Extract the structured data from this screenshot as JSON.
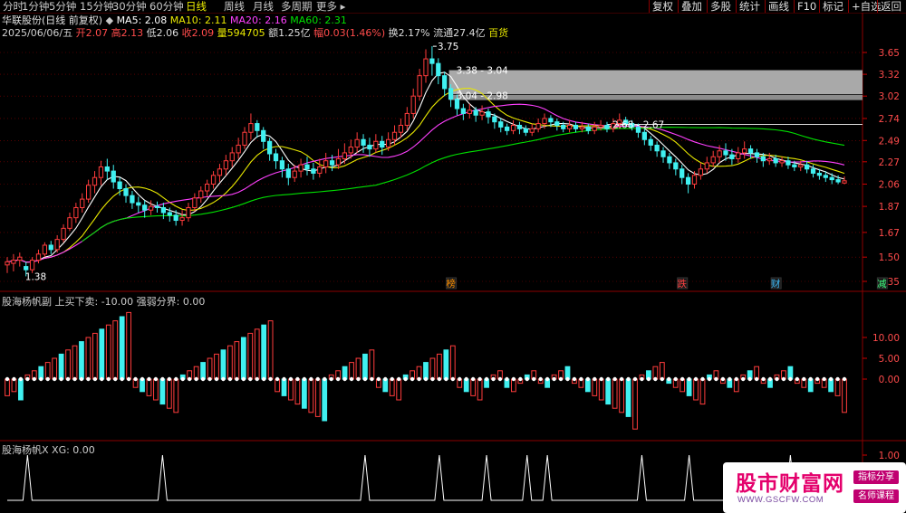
{
  "topbar": {
    "periods": [
      "分时",
      "1分钟",
      "5分钟",
      "15分钟",
      "30分钟",
      "60分钟",
      "日线",
      "周线",
      "月线",
      "多周期",
      "更多"
    ],
    "active_period": "日线",
    "right_buttons": [
      "复权",
      "叠加",
      "多股",
      "统计",
      "画线",
      "F10",
      "标记",
      "+自选",
      "返回"
    ]
  },
  "stock": {
    "name_line": "华联股份(日线 前复权)",
    "ma5": "MA5: 2.08",
    "ma10": "MA10: 2.11",
    "ma20": "MA20: 2.16",
    "ma60": "MA60: 2.31",
    "date": "2025/06/06/五",
    "open": "开2.07",
    "high": "高2.13",
    "low": "低2.06",
    "close": "收2.09",
    "volume": "量594705",
    "amount": "额1.25亿",
    "change": "幅0.03(1.46%)",
    "turnover": "换2.17%",
    "float": "流通27.4亿",
    "sector": "百货"
  },
  "colors": {
    "ma5": "#ffffff",
    "ma10": "#e8e800",
    "ma20": "#ff40ff",
    "ma60": "#00e000",
    "up": "#ff3c3c",
    "down": "#40f0f0",
    "grid": "#8b0000"
  },
  "chart_data": [
    {
      "type": "candlestick",
      "title": "华联股份(日线 前复权)",
      "y_ticks": [
        3.65,
        3.32,
        3.02,
        2.74,
        2.49,
        2.27,
        2.06,
        1.87,
        1.67,
        1.5,
        1.35
      ],
      "ylim": [
        1.3,
        3.85
      ],
      "annotations": [
        "3.75",
        "3.38 - 3.04",
        "3.04 - 2.98",
        "2.68 - 2.67",
        "1.38"
      ],
      "event_markers": [
        "榜",
        "跌",
        "财",
        "减"
      ],
      "candles": [
        [
          1.45,
          1.47,
          1.4,
          1.5
        ],
        [
          1.46,
          1.48,
          1.41,
          1.52
        ],
        [
          1.48,
          1.5,
          1.44,
          1.53
        ],
        [
          1.44,
          1.42,
          1.38,
          1.47
        ],
        [
          1.42,
          1.48,
          1.4,
          1.5
        ],
        [
          1.48,
          1.52,
          1.46,
          1.55
        ],
        [
          1.52,
          1.58,
          1.5,
          1.6
        ],
        [
          1.58,
          1.55,
          1.52,
          1.61
        ],
        [
          1.55,
          1.62,
          1.53,
          1.65
        ],
        [
          1.62,
          1.7,
          1.6,
          1.73
        ],
        [
          1.7,
          1.78,
          1.68,
          1.82
        ],
        [
          1.78,
          1.86,
          1.74,
          1.9
        ],
        [
          1.86,
          1.93,
          1.82,
          1.98
        ],
        [
          1.93,
          2.05,
          1.9,
          2.1
        ],
        [
          2.05,
          2.12,
          1.98,
          2.18
        ],
        [
          2.12,
          2.22,
          2.05,
          2.28
        ],
        [
          2.22,
          2.18,
          2.1,
          2.3
        ],
        [
          2.18,
          2.08,
          2.02,
          2.24
        ],
        [
          2.08,
          2.02,
          1.96,
          2.12
        ],
        [
          2.02,
          1.96,
          1.9,
          2.06
        ],
        [
          1.96,
          1.9,
          1.85,
          2.0
        ],
        [
          1.9,
          1.88,
          1.82,
          1.95
        ],
        [
          1.88,
          1.84,
          1.78,
          1.92
        ],
        [
          1.84,
          1.87,
          1.8,
          1.92
        ],
        [
          1.87,
          1.86,
          1.82,
          1.91
        ],
        [
          1.86,
          1.82,
          1.77,
          1.9
        ],
        [
          1.82,
          1.8,
          1.75,
          1.86
        ],
        [
          1.8,
          1.76,
          1.72,
          1.84
        ],
        [
          1.76,
          1.78,
          1.72,
          1.84
        ],
        [
          1.78,
          1.86,
          1.75,
          1.9
        ],
        [
          1.86,
          1.94,
          1.83,
          1.98
        ],
        [
          1.94,
          2.0,
          1.9,
          2.04
        ],
        [
          2.0,
          2.06,
          1.95,
          2.1
        ],
        [
          2.06,
          2.14,
          2.02,
          2.18
        ],
        [
          2.14,
          2.2,
          2.08,
          2.25
        ],
        [
          2.2,
          2.28,
          2.14,
          2.34
        ],
        [
          2.28,
          2.36,
          2.22,
          2.42
        ],
        [
          2.36,
          2.44,
          2.3,
          2.52
        ],
        [
          2.44,
          2.58,
          2.4,
          2.64
        ],
        [
          2.58,
          2.68,
          2.5,
          2.8
        ],
        [
          2.68,
          2.6,
          2.52,
          2.72
        ],
        [
          2.6,
          2.48,
          2.4,
          2.64
        ],
        [
          2.48,
          2.35,
          2.28,
          2.52
        ],
        [
          2.35,
          2.28,
          2.2,
          2.4
        ],
        [
          2.28,
          2.2,
          2.12,
          2.32
        ],
        [
          2.2,
          2.12,
          2.05,
          2.25
        ],
        [
          2.12,
          2.18,
          2.08,
          2.24
        ],
        [
          2.18,
          2.24,
          2.12,
          2.3
        ],
        [
          2.24,
          2.2,
          2.14,
          2.32
        ],
        [
          2.2,
          2.16,
          2.1,
          2.26
        ],
        [
          2.16,
          2.22,
          2.12,
          2.3
        ],
        [
          2.22,
          2.28,
          2.16,
          2.36
        ],
        [
          2.28,
          2.24,
          2.18,
          2.34
        ],
        [
          2.24,
          2.3,
          2.2,
          2.4
        ],
        [
          2.3,
          2.36,
          2.25,
          2.46
        ],
        [
          2.36,
          2.42,
          2.3,
          2.5
        ],
        [
          2.42,
          2.5,
          2.36,
          2.58
        ],
        [
          2.5,
          2.44,
          2.36,
          2.56
        ],
        [
          2.44,
          2.4,
          2.32,
          2.52
        ],
        [
          2.4,
          2.48,
          2.36,
          2.56
        ],
        [
          2.48,
          2.42,
          2.34,
          2.54
        ],
        [
          2.42,
          2.5,
          2.38,
          2.58
        ],
        [
          2.5,
          2.58,
          2.44,
          2.66
        ],
        [
          2.58,
          2.66,
          2.52,
          2.74
        ],
        [
          2.66,
          2.8,
          2.6,
          2.88
        ],
        [
          2.8,
          3.02,
          2.74,
          3.12
        ],
        [
          3.02,
          3.3,
          2.96,
          3.4
        ],
        [
          3.3,
          3.55,
          3.2,
          3.7
        ],
        [
          3.55,
          3.48,
          3.3,
          3.75
        ],
        [
          3.48,
          3.3,
          3.18,
          3.56
        ],
        [
          3.3,
          3.12,
          3.02,
          3.36
        ],
        [
          3.12,
          2.98,
          2.88,
          3.18
        ],
        [
          2.98,
          2.86,
          2.78,
          3.04
        ],
        [
          2.86,
          2.8,
          2.72,
          2.92
        ],
        [
          2.8,
          2.84,
          2.74,
          2.92
        ],
        [
          2.84,
          2.78,
          2.7,
          2.88
        ],
        [
          2.78,
          2.82,
          2.72,
          2.9
        ],
        [
          2.82,
          2.76,
          2.68,
          2.86
        ],
        [
          2.76,
          2.7,
          2.62,
          2.8
        ],
        [
          2.7,
          2.64,
          2.58,
          2.74
        ],
        [
          2.64,
          2.6,
          2.55,
          2.68
        ],
        [
          2.6,
          2.66,
          2.56,
          2.72
        ],
        [
          2.66,
          2.62,
          2.56,
          2.7
        ],
        [
          2.62,
          2.58,
          2.54,
          2.66
        ],
        [
          2.58,
          2.62,
          2.54,
          2.68
        ],
        [
          2.62,
          2.68,
          2.58,
          2.74
        ],
        [
          2.68,
          2.74,
          2.62,
          2.8
        ],
        [
          2.74,
          2.7,
          2.64,
          2.78
        ],
        [
          2.7,
          2.66,
          2.6,
          2.74
        ],
        [
          2.66,
          2.62,
          2.58,
          2.7
        ],
        [
          2.62,
          2.66,
          2.58,
          2.72
        ],
        [
          2.66,
          2.62,
          2.58,
          2.7
        ],
        [
          2.62,
          2.64,
          2.58,
          2.7
        ],
        [
          2.64,
          2.6,
          2.56,
          2.68
        ],
        [
          2.6,
          2.64,
          2.56,
          2.7
        ],
        [
          2.64,
          2.66,
          2.6,
          2.72
        ],
        [
          2.66,
          2.62,
          2.58,
          2.7
        ],
        [
          2.62,
          2.68,
          2.58,
          2.74
        ],
        [
          2.68,
          2.72,
          2.62,
          2.8
        ],
        [
          2.72,
          2.68,
          2.64,
          2.76
        ],
        [
          2.68,
          2.64,
          2.6,
          2.72
        ],
        [
          2.64,
          2.58,
          2.52,
          2.68
        ],
        [
          2.58,
          2.5,
          2.44,
          2.62
        ],
        [
          2.5,
          2.44,
          2.38,
          2.54
        ],
        [
          2.44,
          2.38,
          2.32,
          2.48
        ],
        [
          2.38,
          2.32,
          2.26,
          2.42
        ],
        [
          2.32,
          2.26,
          2.2,
          2.36
        ],
        [
          2.26,
          2.2,
          2.14,
          2.3
        ],
        [
          2.2,
          2.12,
          2.06,
          2.24
        ],
        [
          2.12,
          2.06,
          1.98,
          2.16
        ],
        [
          2.06,
          2.14,
          2.02,
          2.18
        ],
        [
          2.14,
          2.2,
          2.1,
          2.26
        ],
        [
          2.2,
          2.26,
          2.16,
          2.32
        ],
        [
          2.26,
          2.32,
          2.22,
          2.38
        ],
        [
          2.32,
          2.38,
          2.26,
          2.44
        ],
        [
          2.38,
          2.34,
          2.28,
          2.46
        ],
        [
          2.34,
          2.3,
          2.24,
          2.4
        ],
        [
          2.3,
          2.36,
          2.26,
          2.42
        ],
        [
          2.36,
          2.4,
          2.3,
          2.48
        ],
        [
          2.4,
          2.36,
          2.3,
          2.44
        ],
        [
          2.36,
          2.32,
          2.26,
          2.4
        ],
        [
          2.32,
          2.28,
          2.22,
          2.36
        ],
        [
          2.28,
          2.3,
          2.24,
          2.36
        ],
        [
          2.3,
          2.26,
          2.22,
          2.34
        ],
        [
          2.26,
          2.28,
          2.22,
          2.32
        ],
        [
          2.28,
          2.24,
          2.2,
          2.32
        ],
        [
          2.24,
          2.22,
          2.18,
          2.28
        ],
        [
          2.22,
          2.24,
          2.18,
          2.28
        ],
        [
          2.24,
          2.2,
          2.16,
          2.28
        ],
        [
          2.2,
          2.16,
          2.12,
          2.24
        ],
        [
          2.16,
          2.14,
          2.1,
          2.2
        ],
        [
          2.14,
          2.12,
          2.08,
          2.18
        ],
        [
          2.12,
          2.1,
          2.06,
          2.16
        ],
        [
          2.1,
          2.08,
          2.06,
          2.14
        ],
        [
          2.07,
          2.09,
          2.06,
          2.13
        ]
      ]
    },
    {
      "type": "bar",
      "title": "股海杨帆副 上买下卖: -10.00 强弱分界: 0.00",
      "y_ticks": [
        10.0,
        5.0,
        0.0
      ],
      "values": [
        -4,
        -3,
        -5,
        1,
        2,
        3,
        4,
        5,
        6,
        7,
        8,
        9,
        10,
        11,
        12,
        13,
        14,
        15,
        16,
        -2,
        -3,
        -4,
        -5,
        -6,
        -7,
        -8,
        1,
        2,
        3,
        4,
        5,
        6,
        7,
        8,
        9,
        10,
        11,
        12,
        13,
        14,
        -3,
        -4,
        -5,
        -6,
        -7,
        -8,
        -9,
        -10,
        1,
        2,
        3,
        4,
        5,
        6,
        7,
        -2,
        -3,
        -4,
        -5,
        1,
        2,
        3,
        4,
        5,
        6,
        7,
        8,
        -2,
        -3,
        -4,
        -5,
        -2,
        1,
        2,
        -2,
        -3,
        -1,
        1,
        2,
        -1,
        -2,
        1,
        2,
        3,
        -1,
        -2,
        -3,
        -4,
        -5,
        -6,
        -7,
        -8,
        -9,
        -12,
        1,
        2,
        3,
        4,
        -1,
        -2,
        -3,
        -4,
        -5,
        -6,
        1,
        2,
        -1,
        -2,
        -3,
        1,
        2,
        3,
        -1,
        -2,
        1,
        2,
        3,
        -1,
        -2,
        -3,
        -1,
        -2,
        -3,
        -4,
        -8
      ]
    },
    {
      "type": "line",
      "title": "股海杨帆X XG: 0.00",
      "y_ticks": [
        1.0,
        0.5,
        0.0
      ],
      "spike_positions": [
        3,
        23,
        53,
        64,
        71,
        77,
        80,
        94,
        101,
        116
      ]
    }
  ],
  "watermark": {
    "title": "股市财富网",
    "url": "WWW.GSCFW.COM",
    "tag1": "指标分享",
    "tag2": "名师课程"
  }
}
